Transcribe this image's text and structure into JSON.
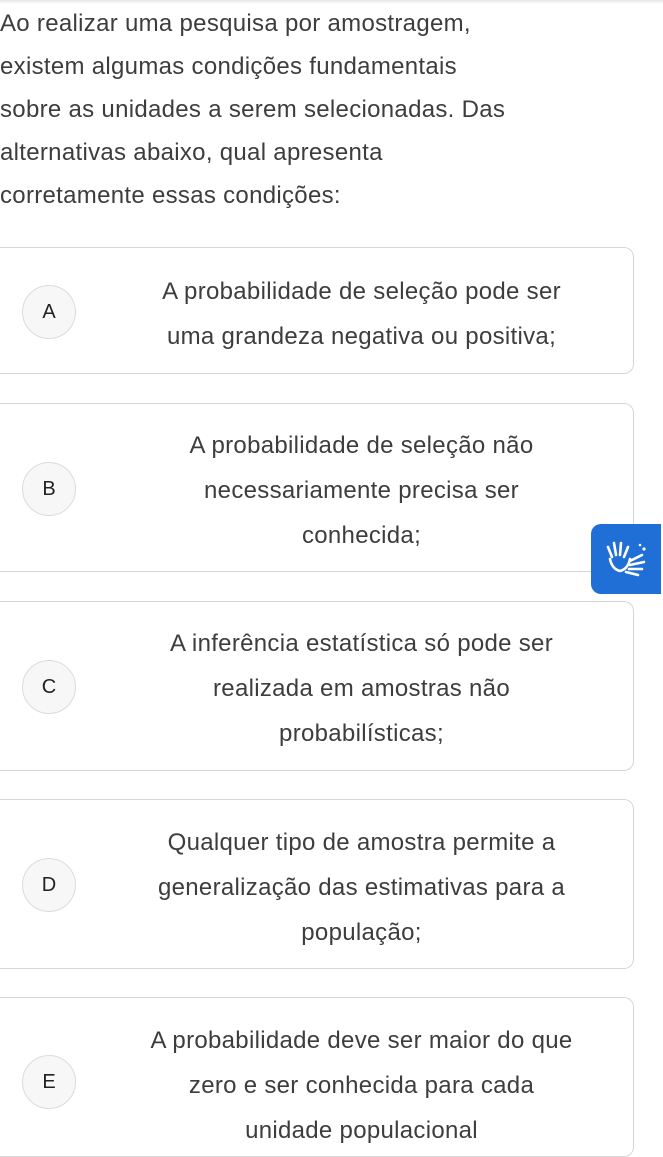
{
  "question": {
    "text": "Ao realizar uma pesquisa por amostragem,\nexistem algumas condições fundamentais\nsobre as unidades a serem selecionadas. Das\nalternativas abaixo, qual apresenta\ncorretamente essas condições:"
  },
  "options": [
    {
      "letter": "A",
      "text": "A probabilidade de seleção pode ser\numa grandeza negativa ou positiva;"
    },
    {
      "letter": "B",
      "text": "A probabilidade de seleção não\nnecessariamente precisa ser\nconhecida;"
    },
    {
      "letter": "C",
      "text": "A inferência estatística só pode ser\nrealizada em amostras não\nprobabilísticas;"
    },
    {
      "letter": "D",
      "text": "Qualquer tipo de amostra permite a\ngeneralização das estimativas para a\npopulação;"
    },
    {
      "letter": "E",
      "text": "A probabilidade deve ser maior do que\nzero e ser conhecida para cada\nunidade populacional"
    }
  ],
  "accessibility": {
    "icon": "sign-language-hands-icon",
    "color": "#1f6fd6"
  }
}
